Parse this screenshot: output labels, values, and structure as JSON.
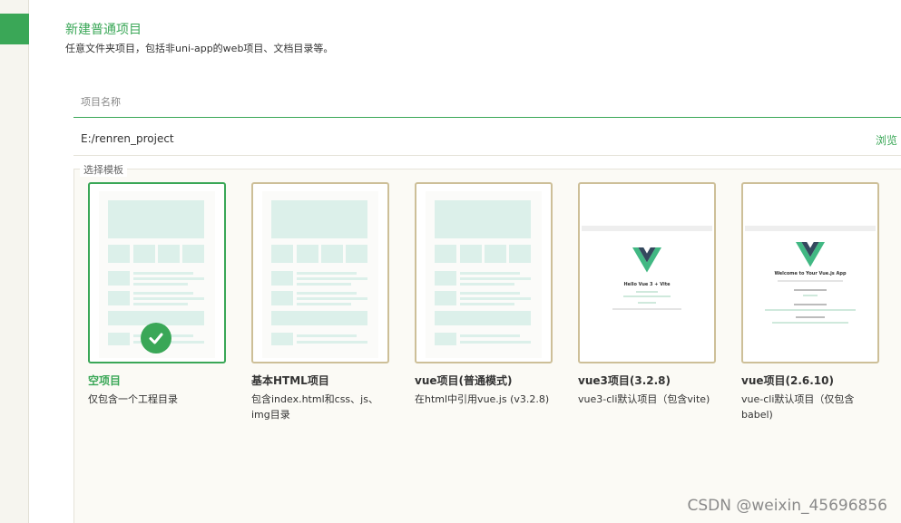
{
  "header": {
    "title": "新建普通项目",
    "subtitle": "任意文件夹项目，包括非uni-app的web项目、文档目录等。"
  },
  "form": {
    "name_placeholder": "项目名称",
    "path_value": "E:/renren_project",
    "browse_label": "浏览"
  },
  "templates": {
    "legend": "选择模板",
    "items": [
      {
        "title": "空项目",
        "desc": "仅包含一个工程目录",
        "selected": true
      },
      {
        "title": "基本HTML项目",
        "desc": "包含index.html和css、js、img目录",
        "selected": false
      },
      {
        "title": "vue项目(普通模式)",
        "desc": "在html中引用vue.js (v3.2.8)",
        "selected": false
      },
      {
        "title": "vue3项目(3.2.8)",
        "desc": "vue3-cli默认项目（包含vite)",
        "selected": false
      },
      {
        "title": "vue项目(2.6.10)",
        "desc": "vue-cli默认项目（仅包含babel)",
        "selected": false
      }
    ]
  },
  "previews": {
    "vue3_heading": "Hello Vue 3 + Vite",
    "vue2_heading": "Welcome to Your Vue.js App"
  },
  "watermark": "CSDN @weixin_45696856",
  "colors": {
    "accent": "#3aa757",
    "card_border": "#cdbf98",
    "placeholder_block": "#dcf0ea"
  }
}
